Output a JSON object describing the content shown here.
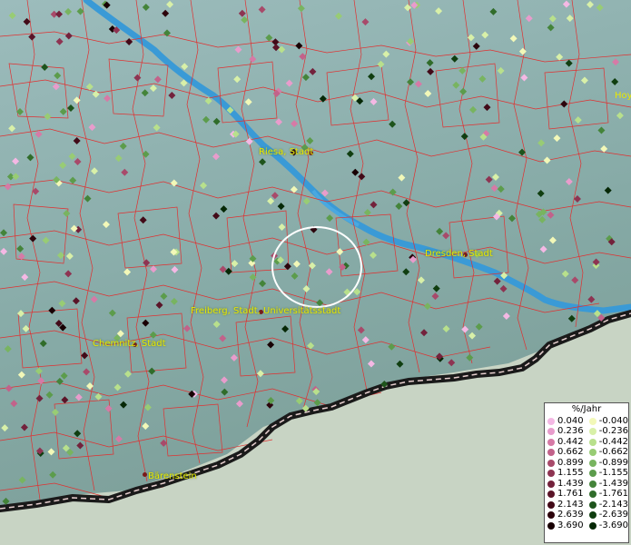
{
  "map": {
    "cities": [
      {
        "name": "Riesa, Stadt"
      },
      {
        "name": "Dresden, Stadt"
      },
      {
        "name": "Freiberg, Stadt, Universitätsstadt"
      },
      {
        "name": "Chemnitz, Stadt"
      },
      {
        "name": "Bärenstein"
      }
    ],
    "edge_label": "Hoy"
  },
  "legend": {
    "title": "%/Jahr",
    "positive": [
      {
        "value": "0.040",
        "color": "#f4b8e4"
      },
      {
        "value": "0.236",
        "color": "#e89ccc"
      },
      {
        "value": "0.442",
        "color": "#d67aa6"
      },
      {
        "value": "0.662",
        "color": "#c2628a"
      },
      {
        "value": "0.899",
        "color": "#a84a6a"
      },
      {
        "value": "1.155",
        "color": "#8e3452"
      },
      {
        "value": "1.439",
        "color": "#73223c"
      },
      {
        "value": "1.761",
        "color": "#5a1428"
      },
      {
        "value": "2.143",
        "color": "#420a18"
      },
      {
        "value": "2.639",
        "color": "#2c040c"
      },
      {
        "value": "3.690",
        "color": "#180004"
      }
    ],
    "negative": [
      {
        "value": "-0.040",
        "color": "#f2f8b8"
      },
      {
        "value": "-0.236",
        "color": "#d8f0a8"
      },
      {
        "value": "-0.442",
        "color": "#b8e08c"
      },
      {
        "value": "-0.662",
        "color": "#98cc74"
      },
      {
        "value": "-0.899",
        "color": "#78b460"
      },
      {
        "value": "-1.155",
        "color": "#5c9c4c"
      },
      {
        "value": "-1.439",
        "color": "#44843a"
      },
      {
        "value": "-1.761",
        "color": "#306c2a"
      },
      {
        "value": "-2.143",
        "color": "#1e541c"
      },
      {
        "value": "-2.639",
        "color": "#103e10"
      },
      {
        "value": "-3.690",
        "color": "#062806"
      }
    ]
  }
}
